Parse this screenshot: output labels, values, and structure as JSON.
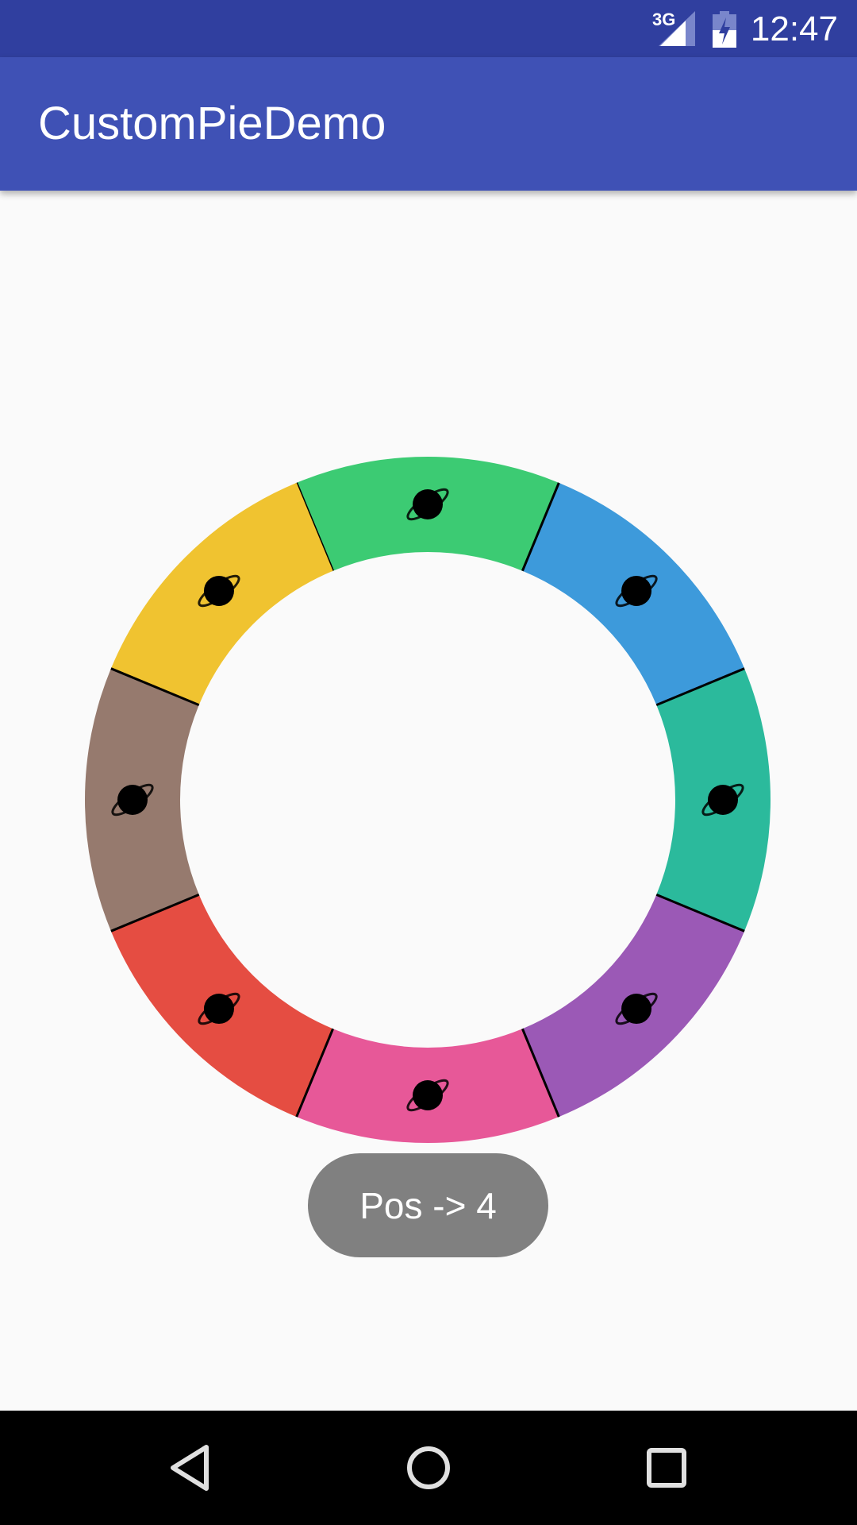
{
  "status_bar": {
    "network": "3G",
    "time": "12:47"
  },
  "app_bar": {
    "title": "CustomPieDemo"
  },
  "toast": {
    "text": "Pos -> 4"
  },
  "chart_data": {
    "type": "pie",
    "style": "donut",
    "slice_icon": "planet-icon",
    "slices": [
      {
        "value": 1,
        "color": "#3CCB73"
      },
      {
        "value": 1,
        "color": "#3D9ADB"
      },
      {
        "value": 1,
        "color": "#2BBA9C"
      },
      {
        "value": 1,
        "color": "#9B59B6"
      },
      {
        "value": 1,
        "color": "#E75898"
      },
      {
        "value": 1,
        "color": "#E54D42"
      },
      {
        "value": 1,
        "color": "#967A6E"
      },
      {
        "value": 1,
        "color": "#F0C330"
      }
    ]
  },
  "nav_bar": {
    "buttons": [
      "back",
      "home",
      "recents"
    ]
  }
}
